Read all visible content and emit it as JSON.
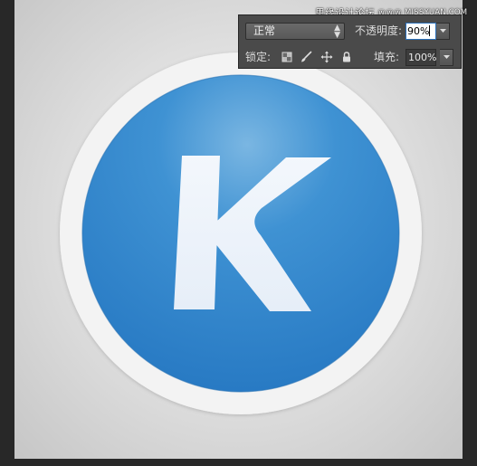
{
  "layers_panel": {
    "blend_mode": "正常",
    "opacity_label": "不透明度:",
    "opacity_value": "90%",
    "lock_label": "锁定:",
    "fill_label": "填充:",
    "fill_value": "100%"
  },
  "watermark": {
    "site_name": "思缘设计论坛",
    "separator": "ⓌⓌⓌ",
    "url": "MISSYUAN.COM"
  },
  "artwork": {
    "letter": "K",
    "circle_color": "#2d84c9",
    "ring_color": "#f3f3f3",
    "letter_color": "#f0f5fb"
  },
  "icons": [
    "lock-transparent-pixels-icon",
    "lock-image-pixels-icon",
    "lock-position-icon",
    "lock-all-icon",
    "dropdown-arrow-icon",
    "stepper-arrows-icon"
  ]
}
